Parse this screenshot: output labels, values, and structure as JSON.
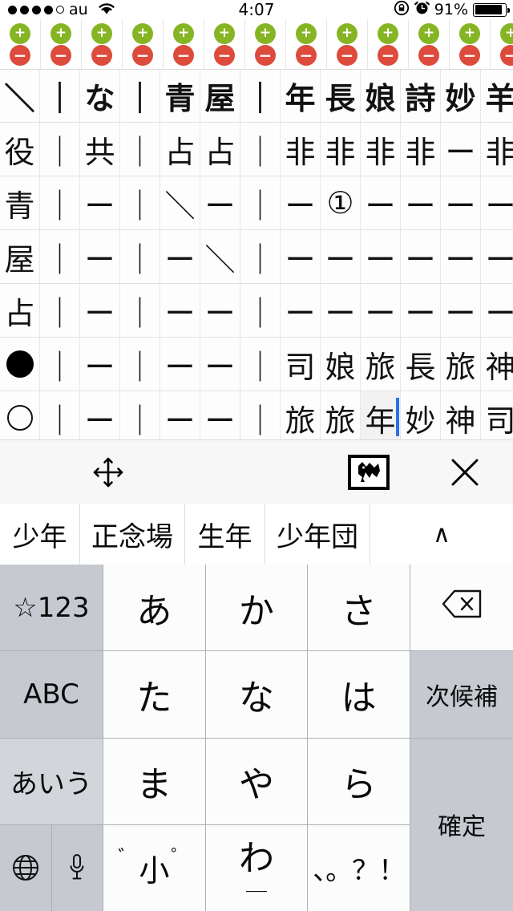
{
  "status_bar": {
    "carrier": "au",
    "signal_dots_filled": 4,
    "signal_dots_total": 5,
    "wifi_icon": "wifi-icon",
    "time": "4:07",
    "lock_rotation_icon": "rotation-lock-icon",
    "alarm_icon": "alarm-clock-icon",
    "battery_percent": "91%",
    "battery_level": 91
  },
  "control_row": {
    "plus_label": "+",
    "minus_label": "−",
    "count": 13
  },
  "sheet": {
    "columns": 13,
    "rows": [
      {
        "header": true,
        "cells": [
          "＼",
          "｜",
          "な",
          "｜",
          "青",
          "屋",
          "｜",
          "年",
          "長",
          "娘",
          "詩",
          "妙",
          "羊"
        ]
      },
      {
        "header": false,
        "cells": [
          "役",
          "｜",
          "共",
          "｜",
          "占",
          "占",
          "｜",
          "非",
          "非",
          "非",
          "非",
          "ー",
          "非"
        ]
      },
      {
        "header": false,
        "cells": [
          "青",
          "｜",
          "ー",
          "｜",
          "＼",
          "ー",
          "｜",
          "ー",
          "①",
          "ー",
          "ー",
          "ー",
          "ー"
        ]
      },
      {
        "header": false,
        "cells": [
          "屋",
          "｜",
          "ー",
          "｜",
          "ー",
          "＼",
          "｜",
          "ー",
          "ー",
          "ー",
          "ー",
          "ー",
          "ー"
        ]
      },
      {
        "header": false,
        "cells": [
          "占",
          "｜",
          "ー",
          "｜",
          "ー",
          "ー",
          "｜",
          "ー",
          "ー",
          "ー",
          "ー",
          "ー",
          "ー"
        ]
      },
      {
        "header": false,
        "cells": [
          "●",
          "｜",
          "ー",
          "｜",
          "ー",
          "ー",
          "｜",
          "司",
          "娘",
          "旅",
          "長",
          "旅",
          "神"
        ]
      },
      {
        "header": false,
        "cells": [
          "○",
          "｜",
          "ー",
          "｜",
          "ー",
          "ー",
          "｜",
          "旅",
          "旅",
          "年",
          "妙",
          "神",
          "司"
        ]
      }
    ],
    "active_cell": {
      "row": 6,
      "col": 9,
      "value": "年"
    },
    "caret_color": "#2f6fe8"
  },
  "toolbar": {
    "move_icon": "move-arrows-icon",
    "image_icon": "critter-image-icon",
    "close_icon": "close-x-icon"
  },
  "suggestions": {
    "items": [
      "少年",
      "正念場",
      "生年",
      "少年団"
    ],
    "expand_icon": "∧"
  },
  "keyboard": {
    "rows": [
      [
        {
          "label": "☆123",
          "type": "fn",
          "name": "key-symbols-123"
        },
        {
          "label": "あ",
          "type": "char",
          "name": "key-a"
        },
        {
          "label": "か",
          "type": "char",
          "name": "key-ka"
        },
        {
          "label": "さ",
          "type": "char",
          "name": "key-sa"
        },
        {
          "label": "",
          "type": "icon",
          "icon": "delete-backspace-icon",
          "name": "key-delete"
        }
      ],
      [
        {
          "label": "ABC",
          "type": "fn",
          "name": "key-abc"
        },
        {
          "label": "た",
          "type": "char",
          "name": "key-ta"
        },
        {
          "label": "な",
          "type": "char",
          "name": "key-na"
        },
        {
          "label": "は",
          "type": "char",
          "name": "key-ha"
        },
        {
          "label": "次候補",
          "type": "fn",
          "name": "key-next-candidate"
        }
      ],
      [
        {
          "label": "あいう",
          "type": "fn",
          "name": "key-aiu"
        },
        {
          "label": "ま",
          "type": "char",
          "name": "key-ma"
        },
        {
          "label": "や",
          "type": "char",
          "name": "key-ya"
        },
        {
          "label": "ら",
          "type": "char",
          "name": "key-ra"
        },
        {
          "label": "確定",
          "type": "fn",
          "name": "key-confirm"
        }
      ],
      [
        {
          "label": "",
          "type": "split",
          "icons": [
            "globe-icon",
            "microphone-icon"
          ],
          "name": "key-globe-mic"
        },
        {
          "label": "゛小゜",
          "type": "char",
          "name": "key-dakuten-small"
        },
        {
          "label": "わ",
          "type": "char",
          "name": "key-wa"
        },
        {
          "label": "、。？！",
          "type": "char",
          "name": "key-punctuation"
        }
      ]
    ]
  },
  "colors": {
    "plus_green": "#86b524",
    "minus_red": "#dc4b3c",
    "caret_blue": "#2f6fe8",
    "keyboard_bg": "#aab0b8",
    "key_fn_bg": "#c6cad0"
  }
}
